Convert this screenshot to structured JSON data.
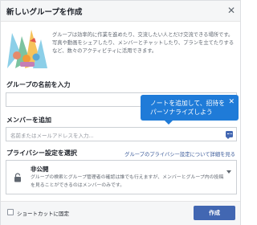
{
  "dialog": {
    "title": "新しいグループを作成",
    "close_icon": "close-icon"
  },
  "intro": {
    "text": "グループは効率的に作業を進めたり、交流したい人とだけ交流できる場所です。写真や動画をシェアしたり、メンバーとチャットしたり、プランを立てたりするなど、数々のアクティビティに活用できます。",
    "illustration": "group-illustration"
  },
  "group_name": {
    "label": "グループの名前を入力",
    "value": "",
    "placeholder": ""
  },
  "members": {
    "label": "メンバーを追加",
    "placeholder": "名前またはメールアドレスを入力...",
    "note_icon": "message-icon"
  },
  "tooltip": {
    "text": "ノートを追加して、招待をパーソナライズしよう",
    "close_icon": "close-icon"
  },
  "privacy": {
    "label": "プライバシー設定を選択",
    "link": "グループのプライバシー設定について詳細を見る",
    "option_title": "非公開",
    "option_desc": "グループの検索とグループ管理者の確認は誰でも行えますが、メンバーとグループ内の投稿を見ることができるのはメンバーのみです。",
    "icon": "lock-icon"
  },
  "footer": {
    "shortcut_label": "ショートカットに固定",
    "create_label": "作成"
  },
  "colors": {
    "primary": "#4267b2",
    "tooltip": "#1f7bd8",
    "link": "#385898"
  }
}
